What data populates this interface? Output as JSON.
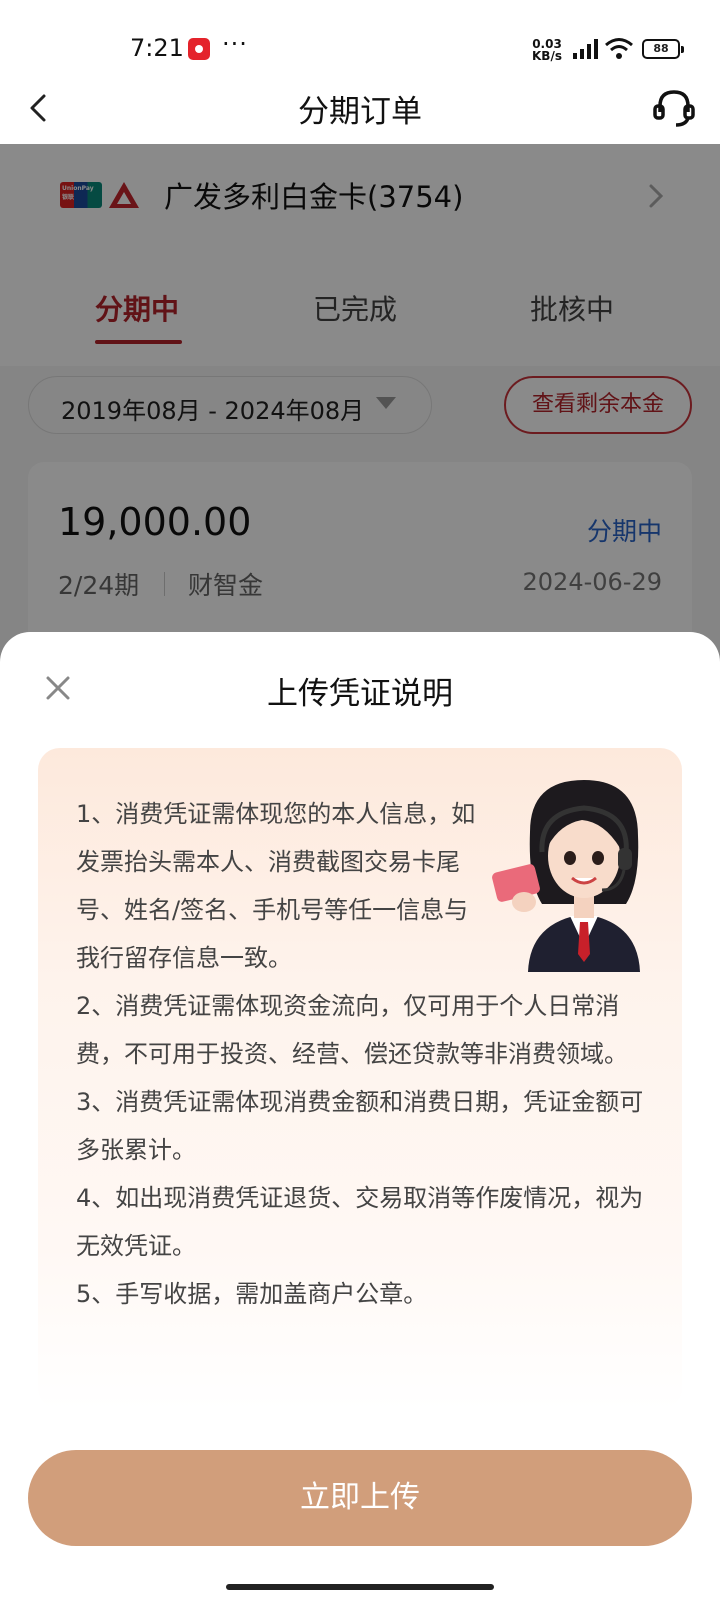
{
  "status_bar": {
    "time": "7:21",
    "dots": "···",
    "net_speed_top": "0.03",
    "net_speed_bottom": "KB/s",
    "battery": "88"
  },
  "header": {
    "title": "分期订单",
    "back_icon": "chevron-left-icon",
    "service_icon": "headset-icon"
  },
  "card": {
    "name": "广发多利白金卡(3754)",
    "unionpay_text": "UnionPay 银联"
  },
  "tabs": [
    {
      "label": "分期中",
      "active": true
    },
    {
      "label": "已完成",
      "active": false
    },
    {
      "label": "批核中",
      "active": false
    }
  ],
  "filter": {
    "date_range": "2019年08月 - 2024年08月",
    "remaining_button": "查看剩余本金"
  },
  "order": {
    "amount": "19,000.00",
    "status": "分期中",
    "period": "2/24期",
    "product": "财智金",
    "date": "2024-06-29"
  },
  "sheet": {
    "title": "上传凭证说明",
    "item1": "1、消费凭证需体现您的本人信息，如发票抬头需本人、消费截图交易卡尾号、姓名/签名、手机号等任一信息与我行留存信息一致。",
    "items": [
      "2、消费凭证需体现资金流向，仅可用于个人日常消费，不可用于投资、经营、偿还贷款等非消费领域。",
      "3、消费凭证需体现消费金额和消费日期，凭证金额可多张累计。",
      "4、如出现消费凭证退货、交易取消等作废情况，视为无效凭证。",
      "5、手写收据，需加盖商户公章。"
    ],
    "upload_button": "立即上传"
  },
  "colors": {
    "brand_red": "#b4232b",
    "button_tan": "#d19e7b",
    "status_blue": "#2a64c8"
  }
}
